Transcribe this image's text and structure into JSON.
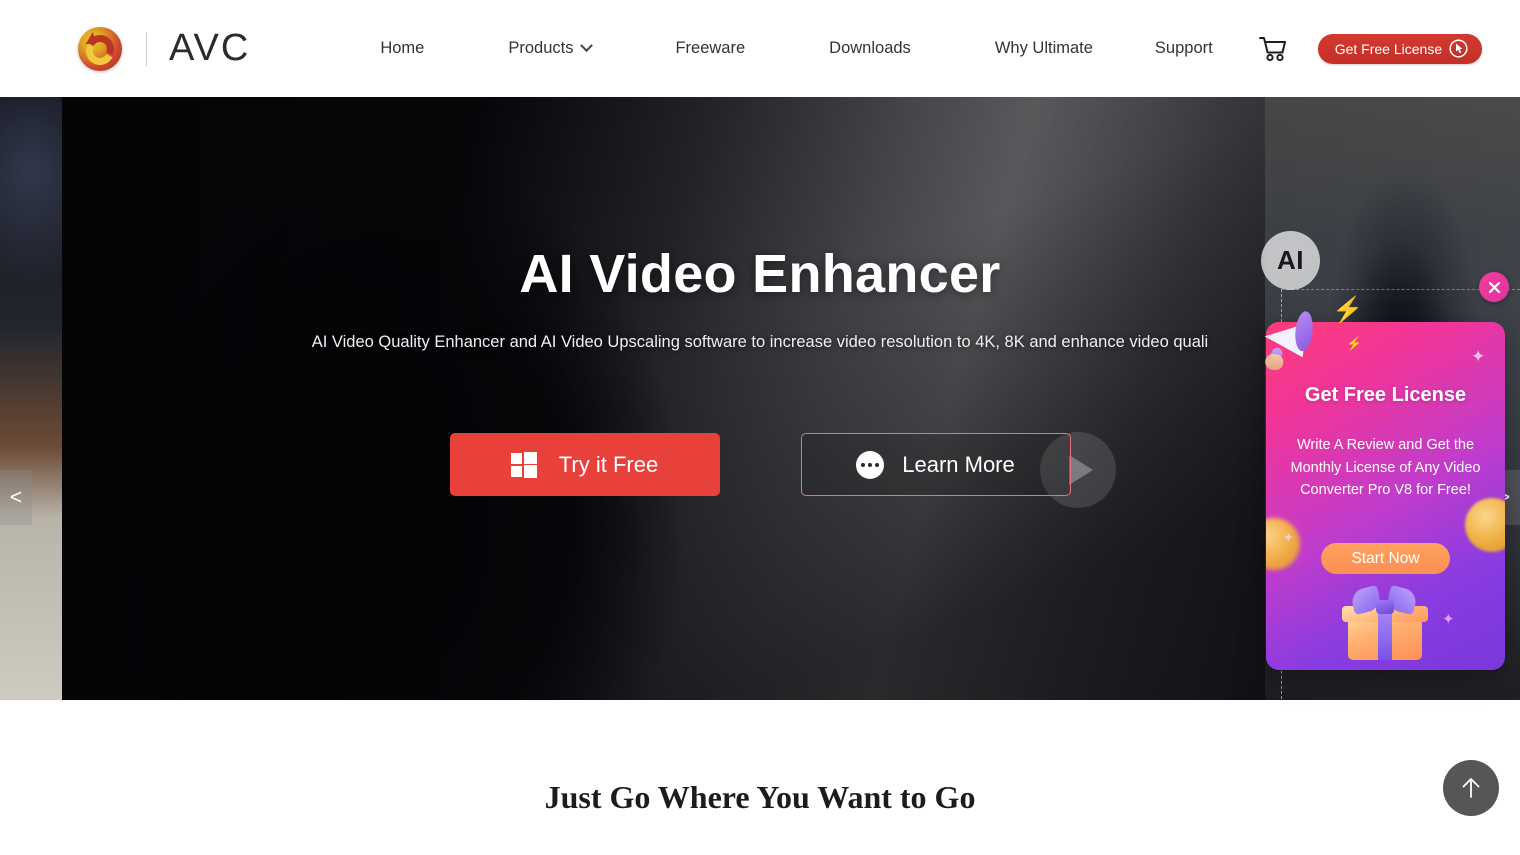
{
  "header": {
    "brand": "AVC",
    "nav": [
      {
        "label": "Home",
        "has_dropdown": false
      },
      {
        "label": "Products",
        "has_dropdown": true
      },
      {
        "label": "Freeware",
        "has_dropdown": false
      },
      {
        "label": "Downloads",
        "has_dropdown": false
      },
      {
        "label": "Why Ultimate",
        "has_dropdown": false
      },
      {
        "label": "Support",
        "has_dropdown": false
      }
    ],
    "cart_icon": "shopping-cart-icon",
    "free_license_label": "Get Free License",
    "free_license_color": "#c9332b"
  },
  "hero": {
    "badge": "AI",
    "title": "AI Video Enhancer",
    "subtitle": "AI Video Quality Enhancer and AI Video Upscaling software to increase video resolution to 4K, 8K and enhance video quali",
    "primary_button": {
      "label": "Try it Free",
      "icon": "windows-icon",
      "color": "#e8413c"
    },
    "secondary_button": {
      "label": "Learn More",
      "icon": "three-dots-icon"
    },
    "prev_arrow": "<",
    "next_arrow": ">",
    "slides": 4,
    "active_slide": 3
  },
  "popup": {
    "title": "Get Free License",
    "description": "Write A Review and Get the Monthly License of Any Video Converter Pro V8 for Free!",
    "cta_label": "Start Now",
    "cta_color": "#fb8f54",
    "close_icon": "close-icon",
    "gradient_from": "#ff3c78",
    "gradient_to": "#7a37dd",
    "megaphone": "📣",
    "bolt_big": "⚡",
    "bolt_small": "⚡",
    "spark1": "✦",
    "spark2": "✦",
    "spark3": "✦"
  },
  "section": {
    "title": "Just Go Where You Want to Go"
  },
  "back_to_top": {
    "icon": "arrow-up-icon"
  }
}
